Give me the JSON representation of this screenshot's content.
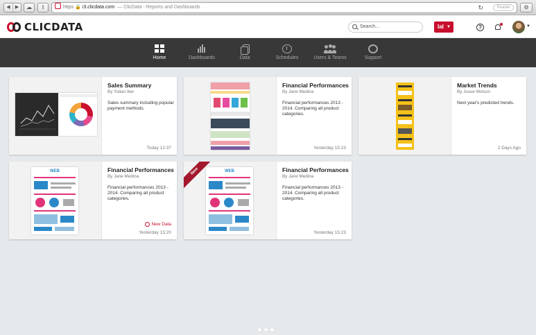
{
  "browser": {
    "protocol": "https",
    "host": "i3.clicdata.com",
    "tab_title": "ClicData - Reports and Dashboards",
    "reader_label": "Reader"
  },
  "header": {
    "logo_text": "CLICDATA",
    "search_placeholder": "Search...",
    "user_button_label": "Ial"
  },
  "nav": {
    "items": [
      {
        "label": "Home",
        "icon": "grid-icon",
        "active": true
      },
      {
        "label": "Dashboards",
        "icon": "bar-chart-icon"
      },
      {
        "label": "Data",
        "icon": "documents-icon"
      },
      {
        "label": "Schedules",
        "icon": "clock-icon"
      },
      {
        "label": "Users & Teams",
        "icon": "users-icon"
      },
      {
        "label": "Support",
        "icon": "lifebuoy-icon"
      }
    ]
  },
  "cards": [
    {
      "title": "Sales Summary",
      "author": "By Yulian Iker",
      "description": "Sales summary including popular payment methods.",
      "time": "Today 12:37"
    },
    {
      "title": "Financial Performances",
      "author": "By Jane Medina",
      "description": "Financial performances 2013 - 2014. Comparing all product categories.",
      "time": "Yesterday 15:23"
    },
    {
      "title": "Market Trends",
      "author": "By Josue Molson",
      "description": "Next year's predicted trends.",
      "time": "2 Days Ago"
    },
    {
      "title": "Financial Performances",
      "author": "By Jane Medina",
      "description": "Financial performances 2013 - 2014. Comparing all product categories.",
      "time": "Yesterday 15:20",
      "badge": "New Data"
    },
    {
      "title": "Financial Performances",
      "author": "By Jane Medina",
      "description": "Financial performances 2013 - 2014. Comparing all product categories.",
      "time": "Yesterday 15:23",
      "ribbon": "New"
    }
  ],
  "thumbs": {
    "poster_heading": "WEB"
  },
  "colors": {
    "brand_red": "#c8102e",
    "nav_bg": "#383838",
    "page_bg": "#e6e9ec"
  }
}
